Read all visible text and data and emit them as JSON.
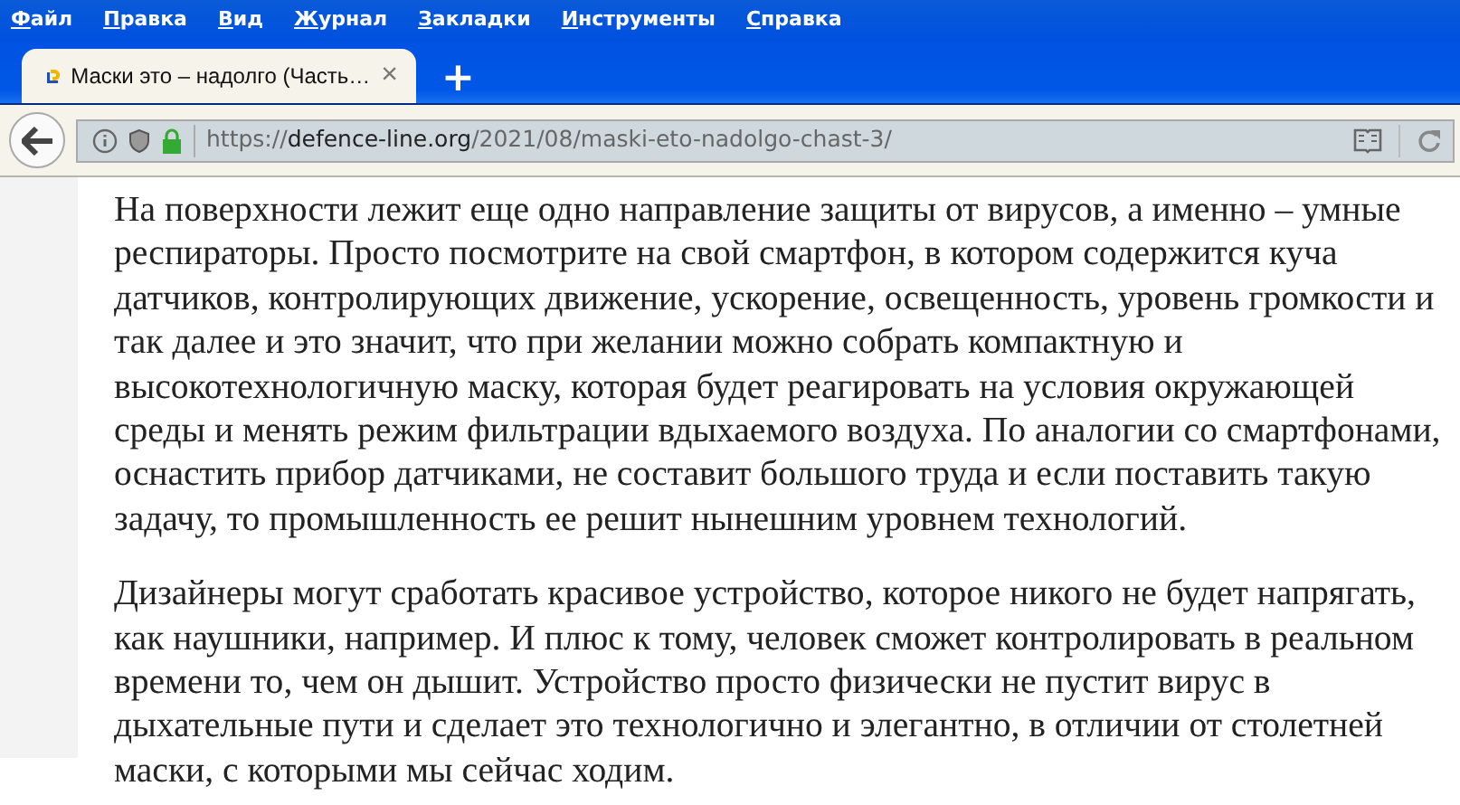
{
  "menu_bar": [
    "Файл",
    "Правка",
    "Вид",
    "Журнал",
    "Закладки",
    "Инструменты",
    "Справка"
  ],
  "tabs": [
    {
      "title": "Маски это – надолго (Часть…",
      "selected": true,
      "close": "×"
    }
  ],
  "new_tab": "+",
  "address_bar": {
    "scheme": "https://",
    "host": "defence-line.org",
    "path": "/2021/08/maski-eto-nadolgo-chast-3/"
  },
  "article": {
    "paragraphs": [
      "На поверхности лежит еще одно направление защиты от вирусов, а именно – умные респираторы. Просто посмотрите на свой смартфон, в котором содержится куча датчиков, контролирующих движение, ускорение, освещенность, уровень громкости и так далее и это значит, что при желании можно собрать компактную и высокотехнологичную маску, которая будет реагировать на условия окружающей среды и менять режим фильтрации вдыхаемого воздуха. По аналогии со смартфонами, оснастить прибор датчиками, не составит большого труда и если поставить такую задачу, то промышленность ее решит нынешним уровнем технологий.",
      "Дизайнеры могут сработать красивое устройство, которое никого не будет напрягать, как наушники, например. И плюс к тому, человек сможет контролировать в реальном времени то, чем он дышит. Устройство просто физически не пустит вирус в дыхательные пути и сделает это технологично и элегантно, в отличии от столетней маски, с которыми мы сейчас ходим."
    ]
  }
}
